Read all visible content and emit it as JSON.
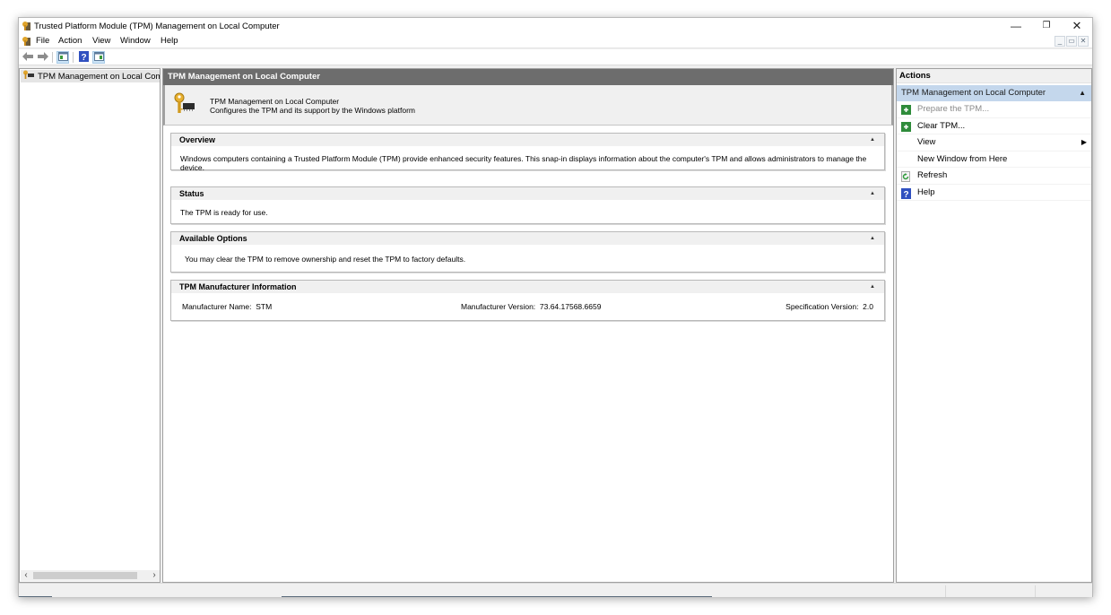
{
  "window": {
    "title": "Trusted Platform Module (TPM) Management on Local Computer",
    "controls": {
      "minimize": "—",
      "maximize": "❐",
      "close": "✕"
    },
    "mdi_controls": {
      "minimize": "_",
      "restore": "▭",
      "close": "✕"
    }
  },
  "menubar": {
    "items": [
      {
        "label": "File"
      },
      {
        "label": "Action"
      },
      {
        "label": "View"
      },
      {
        "label": "Window"
      },
      {
        "label": "Help"
      }
    ]
  },
  "toolbar": {
    "buttons": [
      {
        "icon": "back-arrow-icon"
      },
      {
        "icon": "forward-arrow-icon"
      },
      {
        "icon": "show-hide-console-tree-icon"
      },
      {
        "icon": "help-icon"
      },
      {
        "icon": "show-hide-action-pane-icon"
      }
    ]
  },
  "tree": {
    "items": [
      {
        "label": "TPM Management on Local Comp",
        "selected": true
      }
    ]
  },
  "center": {
    "header": "TPM Management on Local Computer",
    "intro": {
      "title": "TPM Management on Local Computer",
      "subtitle": "Configures the TPM and its support by the Windows platform"
    },
    "sections": {
      "overview": {
        "title": "Overview",
        "body": "Windows computers containing a Trusted Platform Module (TPM) provide enhanced security features. This snap-in displays information about the computer's TPM and allows administrators to manage the device."
      },
      "status": {
        "title": "Status",
        "body": "The TPM is ready for use."
      },
      "options": {
        "title": "Available Options",
        "body": "You may clear the TPM to remove ownership and reset the TPM to factory defaults."
      },
      "manufacturer": {
        "title": "TPM Manufacturer Information",
        "name_label": "Manufacturer Name:",
        "name_value": "STM",
        "version_label": "Manufacturer Version:",
        "version_value": "73.64.17568.6659",
        "spec_label": "Specification Version:",
        "spec_value": "2.0"
      }
    },
    "collapse_glyph": "▲"
  },
  "actions": {
    "header": "Actions",
    "group": "TPM Management on Local Computer",
    "items": [
      {
        "label": "Prepare the TPM...",
        "icon": "green-action-icon",
        "disabled": true
      },
      {
        "label": "Clear TPM...",
        "icon": "green-action-icon",
        "disabled": false
      },
      {
        "label": "View",
        "icon": "",
        "submenu": true
      },
      {
        "label": "New Window from Here",
        "icon": ""
      },
      {
        "label": "Refresh",
        "icon": "refresh-icon"
      },
      {
        "label": "Help",
        "icon": "help-icon"
      }
    ]
  },
  "colors": {
    "center_header_bg": "#6d6d6d",
    "actions_group_bg": "#c4d7ec",
    "action_icon_green": "#2e8b3a",
    "help_icon_blue": "#3050c0"
  }
}
